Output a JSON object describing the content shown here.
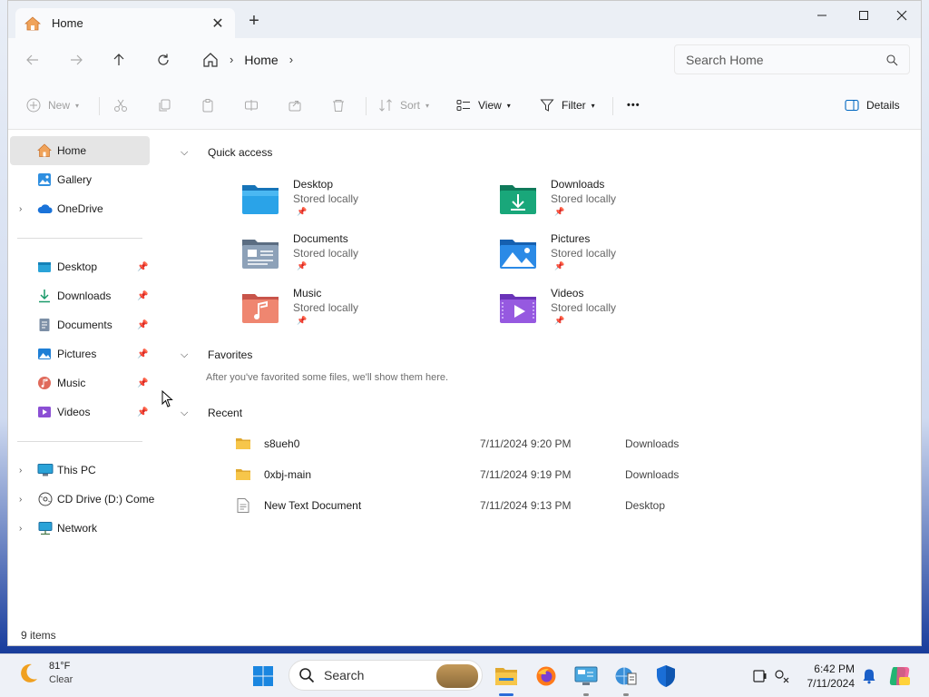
{
  "window": {
    "tab_title": "Home",
    "new_tab_symbol": "+",
    "close_tab_symbol": "✕"
  },
  "address": {
    "crumbs": [
      "Home"
    ],
    "search_placeholder": "Search Home"
  },
  "commandbar": {
    "new_label": "New",
    "sort_label": "Sort",
    "view_label": "View",
    "filter_label": "Filter",
    "more_label": "•••",
    "details_label": "Details"
  },
  "sidebar": {
    "top_items": [
      {
        "label": "Home",
        "icon": "home-icon",
        "selected": true
      },
      {
        "label": "Gallery",
        "icon": "gallery-icon"
      },
      {
        "label": "OneDrive",
        "icon": "cloud-icon",
        "expandable": true
      }
    ],
    "pinned_items": [
      {
        "label": "Desktop",
        "icon": "desktop-folder-icon"
      },
      {
        "label": "Downloads",
        "icon": "download-icon"
      },
      {
        "label": "Documents",
        "icon": "documents-icon"
      },
      {
        "label": "Pictures",
        "icon": "pictures-icon"
      },
      {
        "label": "Music",
        "icon": "music-icon"
      },
      {
        "label": "Videos",
        "icon": "videos-icon"
      }
    ],
    "device_items": [
      {
        "label": "This PC",
        "icon": "monitor-icon"
      },
      {
        "label": "CD Drive (D:) Come",
        "icon": "cd-drive-icon"
      },
      {
        "label": "Network",
        "icon": "network-icon"
      }
    ]
  },
  "content": {
    "quick_access": {
      "header": "Quick access",
      "items": [
        {
          "name": "Desktop",
          "sub": "Stored locally",
          "icon": "desktop-folder-icon"
        },
        {
          "name": "Downloads",
          "sub": "Stored locally",
          "icon": "downloads-folder-icon"
        },
        {
          "name": "Documents",
          "sub": "Stored locally",
          "icon": "documents-folder-icon"
        },
        {
          "name": "Pictures",
          "sub": "Stored locally",
          "icon": "pictures-folder-icon"
        },
        {
          "name": "Music",
          "sub": "Stored locally",
          "icon": "music-folder-icon"
        },
        {
          "name": "Videos",
          "sub": "Stored locally",
          "icon": "videos-folder-icon"
        }
      ]
    },
    "favorites": {
      "header": "Favorites",
      "empty_text": "After you've favorited some files, we'll show them here."
    },
    "recent": {
      "header": "Recent",
      "items": [
        {
          "name": "s8ueh0",
          "date": "7/11/2024 9:20 PM",
          "location": "Downloads",
          "icon": "folder-icon"
        },
        {
          "name": "0xbj-main",
          "date": "7/11/2024 9:19 PM",
          "location": "Downloads",
          "icon": "folder-icon"
        },
        {
          "name": "New Text Document",
          "date": "7/11/2024 9:13 PM",
          "location": "Desktop",
          "icon": "text-file-icon"
        }
      ]
    }
  },
  "status": {
    "item_count": "9 items"
  },
  "taskbar": {
    "weather_temp": "81°F",
    "weather_cond": "Clear",
    "search_label": "Search",
    "time": "6:42 PM",
    "date": "7/11/2024"
  },
  "colors": {
    "accent": "#0067c0",
    "selected_bg": "#e5e5e5"
  }
}
